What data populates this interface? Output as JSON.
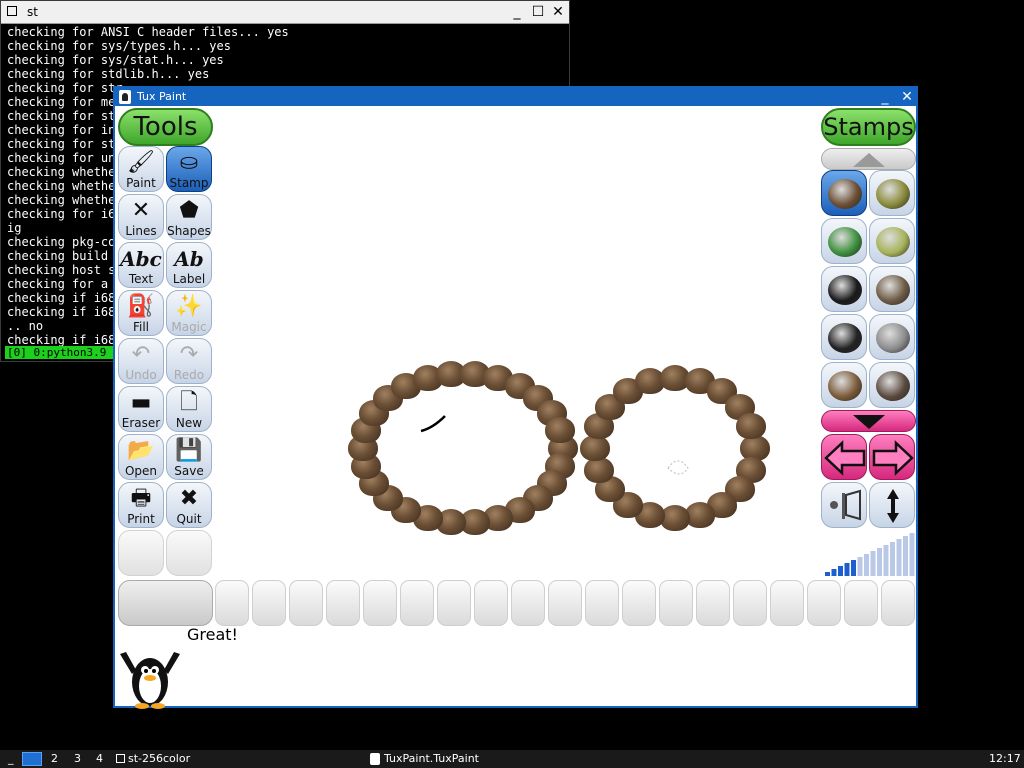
{
  "terminal": {
    "title": "st",
    "lines": [
      "checking for ANSI C header files... yes",
      "checking for sys/types.h... yes",
      "checking for sys/stat.h... yes",
      "checking for stdlib.h... yes",
      "checking for str",
      "checking for me",
      "checking for st",
      "checking for in",
      "checking for st",
      "checking for un",
      "checking whethe",
      "checking whethe",
      "checking whethe",
      "checking for i6",
      "ig",
      "checking pkg-co",
      "checking build",
      "checking host s",
      "checking for a",
      "checking if i68",
      "checking if i68",
      ".. no",
      "checking if i68"
    ],
    "status": "[0] 0:python3.9"
  },
  "tuxpaint": {
    "title": "Tux Paint",
    "tools_title": "Tools",
    "stamps_title": "Stamps",
    "tools": [
      {
        "label": "Paint",
        "icon": "paintbrush-icon",
        "glyph": "🖌",
        "selected": false,
        "disabled": false
      },
      {
        "label": "Stamp",
        "icon": "stamp-icon",
        "glyph": "⛀",
        "selected": true,
        "disabled": false
      },
      {
        "label": "Lines",
        "icon": "lines-icon",
        "glyph": "✕",
        "selected": false,
        "disabled": false
      },
      {
        "label": "Shapes",
        "icon": "pentagon-icon",
        "glyph": "⬟",
        "selected": false,
        "disabled": false
      },
      {
        "label": "Text",
        "icon": "text-abc-icon",
        "glyph": "Abc",
        "selected": false,
        "disabled": false
      },
      {
        "label": "Label",
        "icon": "label-ab-icon",
        "glyph": "Ab",
        "selected": false,
        "disabled": false
      },
      {
        "label": "Fill",
        "icon": "paint-bucket-icon",
        "glyph": "⛽",
        "selected": false,
        "disabled": false
      },
      {
        "label": "Magic",
        "icon": "magic-wand-icon",
        "glyph": "✨",
        "selected": false,
        "disabled": true
      },
      {
        "label": "Undo",
        "icon": "undo-hand-icon",
        "glyph": "↶",
        "selected": false,
        "disabled": true
      },
      {
        "label": "Redo",
        "icon": "redo-hand-icon",
        "glyph": "↷",
        "selected": false,
        "disabled": true
      },
      {
        "label": "Eraser",
        "icon": "eraser-icon",
        "glyph": "▬",
        "selected": false,
        "disabled": false
      },
      {
        "label": "New",
        "icon": "new-page-icon",
        "glyph": "🗋",
        "selected": false,
        "disabled": false
      },
      {
        "label": "Open",
        "icon": "open-folder-icon",
        "glyph": "📂",
        "selected": false,
        "disabled": false
      },
      {
        "label": "Save",
        "icon": "save-icon",
        "glyph": "💾",
        "selected": false,
        "disabled": false
      },
      {
        "label": "Print",
        "icon": "printer-icon",
        "glyph": "🖶",
        "selected": false,
        "disabled": false
      },
      {
        "label": "Quit",
        "icon": "quit-x-icon",
        "glyph": "✖",
        "selected": false,
        "disabled": false
      }
    ],
    "stamps": [
      {
        "name": "toad-stamp",
        "color": "#6b4f35",
        "selected": true
      },
      {
        "name": "frog-stamp",
        "color": "#8a8a3a",
        "selected": false
      },
      {
        "name": "parrot-stamp",
        "color": "#3d8f3d",
        "selected": false
      },
      {
        "name": "iguana-stamp",
        "color": "#a7b35a",
        "selected": false
      },
      {
        "name": "crow-stamp",
        "color": "#1a1a1a",
        "selected": false
      },
      {
        "name": "grouse-stamp",
        "color": "#6e5a44",
        "selected": false
      },
      {
        "name": "raven-stamp",
        "color": "#222222",
        "selected": false
      },
      {
        "name": "crane-stamp",
        "color": "#8c8c8c",
        "selected": false
      },
      {
        "name": "hawk-stamp",
        "color": "#7b5a3a",
        "selected": false
      },
      {
        "name": "goose-stamp",
        "color": "#5b4a3e",
        "selected": false
      }
    ],
    "tip_text": "Great!",
    "colors": {
      "accent": "#1565c0",
      "tools_pill": "#4caf50",
      "selected_tool": "#1d5fb8",
      "scroll_down": "#d6287d"
    }
  },
  "taskbar": {
    "workspaces": [
      "2",
      "3",
      "4"
    ],
    "task1": "st-256color",
    "task2": "TuxPaint.TuxPaint",
    "clock": "12:17"
  }
}
